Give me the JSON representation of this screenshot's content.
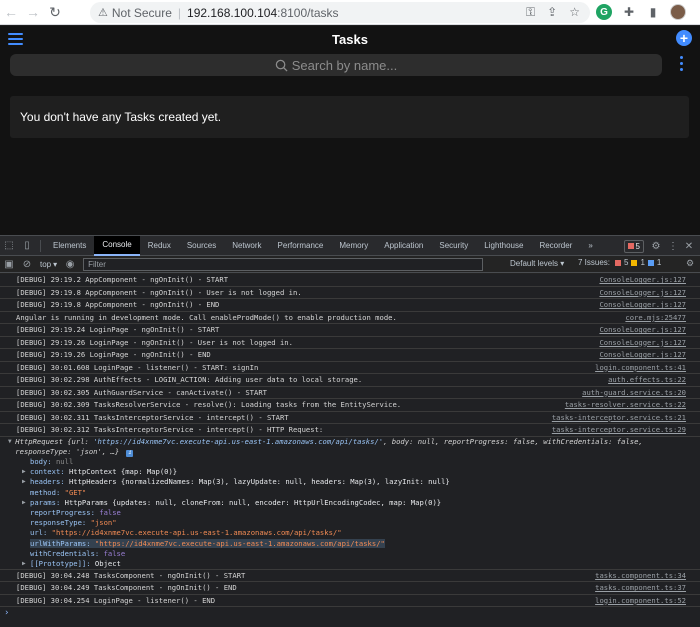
{
  "browser": {
    "security_label": "Not Secure",
    "separator": "|",
    "url_host": "192.168.100.104",
    "url_path": ":8100/tasks"
  },
  "app": {
    "title": "Tasks",
    "search_placeholder": "Search by name...",
    "empty_message": "You don't have any Tasks created yet.",
    "accent_color": "#428cff"
  },
  "devtools": {
    "tabs": [
      "Elements",
      "Console",
      "Redux",
      "Sources",
      "Network",
      "Performance",
      "Memory",
      "Application",
      "Security",
      "Lighthouse",
      "Recorder"
    ],
    "active_tab": "Console",
    "more": "»",
    "error_count": "5",
    "toolbar": {
      "context": "top",
      "filter_placeholder": "Filter",
      "levels": "Default levels",
      "issues_label": "7 Issues:",
      "issues_errors": "5",
      "issues_warnings": "1",
      "issues_info": "1"
    },
    "logs_before": [
      {
        "msg": "[DEBUG] 29:19.2 AppComponent - ngOnInit() - START",
        "src": "ConsoleLogger.js:127"
      },
      {
        "msg": "[DEBUG] 29:19.8 AppComponent - ngOnInit() - User is not logged in.",
        "src": "ConsoleLogger.js:127"
      },
      {
        "msg": "[DEBUG] 29:19.8 AppComponent - ngOnInit() - END",
        "src": "ConsoleLogger.js:127"
      },
      {
        "msg": "Angular is running in development mode. Call enableProdMode() to enable production mode.",
        "src": "core.mjs:25477"
      },
      {
        "msg": "[DEBUG] 29:19.24 LoginPage - ngOnInit() - START",
        "src": "ConsoleLogger.js:127"
      },
      {
        "msg": "[DEBUG] 29:19.26 LoginPage - ngOnInit() - User is not logged in.",
        "src": "ConsoleLogger.js:127"
      },
      {
        "msg": "[DEBUG] 29:19.26 LoginPage - ngOnInit() - END",
        "src": "ConsoleLogger.js:127"
      },
      {
        "msg": "[DEBUG] 30:01.608 LoginPage - listener() - START: signIn",
        "src": "login.component.ts:41"
      },
      {
        "msg": "[DEBUG] 30:02.298 AuthEffects - LOGIN_ACTION: Adding user data to local storage.",
        "src": "auth.effects.ts:22"
      },
      {
        "msg": "[DEBUG] 30:02.305 AuthGuardService - canActivate() - START",
        "src": "auth-guard.service.ts:20"
      },
      {
        "msg": "[DEBUG] 30:02.309 TasksResolverService - resolve(): Loading tasks from the EntityService.",
        "src": "tasks-resolver.service.ts:22"
      },
      {
        "msg": "[DEBUG] 30:02.311 TasksInterceptorService - intercept() - START",
        "src": "tasks-interceptor.service.ts:21"
      },
      {
        "msg": "[DEBUG] 30:02.312 TasksInterceptorService - intercept() - HTTP Request:",
        "src": "tasks-interceptor.service.ts:29"
      }
    ],
    "http_request": {
      "summary_a": "HttpRequest {url: ",
      "summary_url": "'https://id4xnme7vc.execute-api.us-east-1.amazonaws.com/api/tasks/'",
      "summary_b": ", body: null, reportProgress: false, withCredentials: false, responseType: 'json', …}",
      "info": "i",
      "body": {
        "key": "body:",
        "value": "null"
      },
      "context": {
        "key": "context:",
        "value": "HttpContext {map: Map(0)}"
      },
      "headers": {
        "key": "headers:",
        "value": "HttpHeaders {normalizedNames: Map(3), lazyUpdate: null, headers: Map(3), lazyInit: null}"
      },
      "method": {
        "key": "method:",
        "value": "\"GET\""
      },
      "params": {
        "key": "params:",
        "value": "HttpParams {updates: null, cloneFrom: null, encoder: HttpUrlEncodingCodec, map: Map(0)}"
      },
      "reportProgress": {
        "key": "reportProgress:",
        "value": "false"
      },
      "responseType": {
        "key": "responseType:",
        "value": "\"json\""
      },
      "url": {
        "key": "url:",
        "value": "\"https://id4xnme7vc.execute-api.us-east-1.amazonaws.com/api/tasks/\""
      },
      "urlWithParams": {
        "key": "urlWithParams:",
        "value": "\"https://id4xnme7vc.execute-api.us-east-1.amazonaws.com/api/tasks/\""
      },
      "withCredentials": {
        "key": "withCredentials:",
        "value": "false"
      },
      "prototype": {
        "key": "[[Prototype]]:",
        "value": "Object"
      }
    },
    "logs_after": [
      {
        "msg": "[DEBUG] 30:04.248 TasksComponent - ngOnInit() - START",
        "src": "tasks.component.ts:34"
      },
      {
        "msg": "[DEBUG] 30:04.249 TasksComponent - ngOnInit() - END",
        "src": "tasks.component.ts:37"
      },
      {
        "msg": "[DEBUG] 30:04.254 LoginPage - listener() - END",
        "src": "login.component.ts:52"
      }
    ],
    "prompt": "›"
  }
}
